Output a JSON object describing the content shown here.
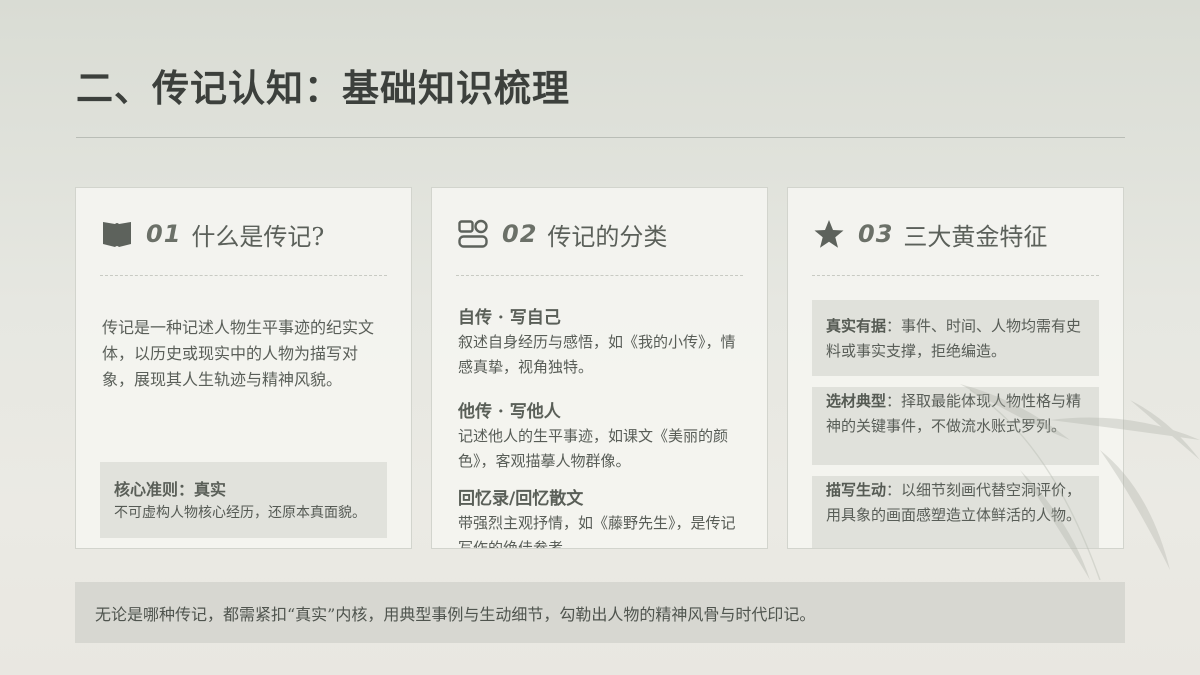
{
  "page": {
    "title": "二、传记认知：基础知识梳理"
  },
  "cards": [
    {
      "num": "01",
      "name": "什么是传记?",
      "icon": "book-icon",
      "body": "传记是一种记述人物生平事迹的纪实文体，以历史或现实中的人物为描写对象，展现其人生轨迹与精神风貌。",
      "core": {
        "title": "核心准则：真实",
        "text": "不可虚构人物核心经历，还原本真面貌。"
      }
    },
    {
      "num": "02",
      "name": "传记的分类",
      "icon": "category-icon",
      "types": [
        {
          "title": "自传 · 写自己",
          "text": "叙述自身经历与感悟，如《我的小传》，情感真挚，视角独特。"
        },
        {
          "title": "他传 · 写他人",
          "text": "记述他人的生平事迹，如课文《美丽的颜色》，客观描摹人物群像。"
        },
        {
          "title": "回忆录/回忆散文",
          "text": "带强烈主观抒情，如《藤野先生》，是传记写作的绝佳参考。"
        }
      ]
    },
    {
      "num": "03",
      "name": "三大黄金特征",
      "icon": "star-icon",
      "features": [
        {
          "key": "真实有据",
          "text": "：事件、时间、人物均需有史料或事实支撑，拒绝编造。"
        },
        {
          "key": "选材典型",
          "text": "：择取最能体现人物性格与精神的关键事件，不做流水账式罗列。"
        },
        {
          "key": "描写生动",
          "text": "：以细节刻画代替空洞评价，用具象的画面感塑造立体鲜活的人物。"
        }
      ]
    }
  ],
  "summary": "无论是哪种传记，都需紧扣“真实”内核，用典型事例与生动细节，勾勒出人物的精神风骨与时代印记。"
}
